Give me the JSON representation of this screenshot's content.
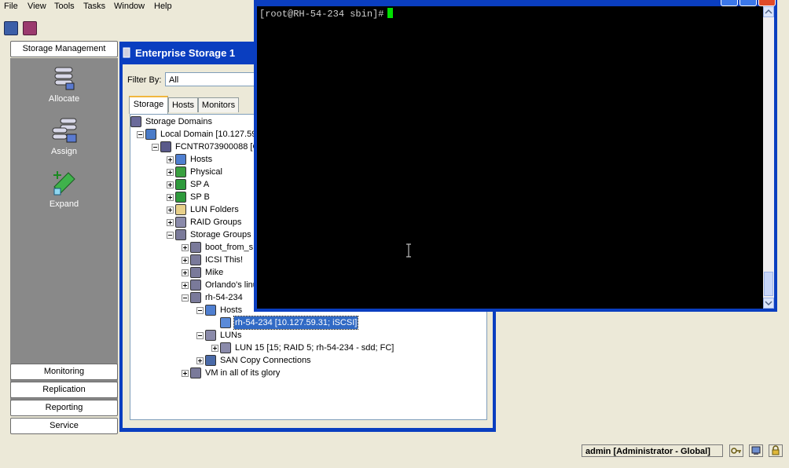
{
  "menu": [
    "File",
    "View",
    "Tools",
    "Tasks",
    "Window",
    "Help"
  ],
  "nav": {
    "storage_management": "Storage Management",
    "tools": [
      {
        "label": "Allocate",
        "icon": "allocate-icon"
      },
      {
        "label": "Assign",
        "icon": "assign-icon"
      },
      {
        "label": "Expand",
        "icon": "expand-icon"
      }
    ],
    "bottom": [
      "Monitoring",
      "Replication",
      "Reporting",
      "Service"
    ]
  },
  "enterprise_window": {
    "title": "Enterprise Storage 1",
    "filter_label": "Filter By:",
    "filter_value": "All",
    "tabs": [
      "Storage",
      "Hosts",
      "Monitors"
    ],
    "active_tab": "Storage"
  },
  "tree": [
    {
      "label": "Storage Domains",
      "depth": 0,
      "expander": "none",
      "icon": "storage-domains-icon"
    },
    {
      "label": "Local Domain [10.127.59",
      "depth": 1,
      "expander": "minus",
      "icon": "domain-icon"
    },
    {
      "label": "FCNTR073900088 [C",
      "depth": 2,
      "expander": "minus",
      "icon": "array-icon"
    },
    {
      "label": "Hosts",
      "depth": 3,
      "expander": "plus",
      "icon": "hosts-icon"
    },
    {
      "label": "Physical",
      "depth": 3,
      "expander": "plus",
      "icon": "physical-icon"
    },
    {
      "label": "SP A",
      "depth": 3,
      "expander": "plus",
      "icon": "sp-icon"
    },
    {
      "label": "SP B",
      "depth": 3,
      "expander": "plus",
      "icon": "sp-icon"
    },
    {
      "label": "LUN Folders",
      "depth": 3,
      "expander": "plus",
      "icon": "folder-icon"
    },
    {
      "label": "RAID Groups",
      "depth": 3,
      "expander": "plus",
      "icon": "raid-icon"
    },
    {
      "label": "Storage Groups",
      "depth": 3,
      "expander": "minus",
      "icon": "storage-group-icon"
    },
    {
      "label": "boot_from_s",
      "depth": 4,
      "expander": "plus",
      "icon": "storage-group-icon"
    },
    {
      "label": "ICSI This!",
      "depth": 4,
      "expander": "plus",
      "icon": "storage-group-icon"
    },
    {
      "label": "Mike",
      "depth": 4,
      "expander": "plus",
      "icon": "storage-group-icon"
    },
    {
      "label": "Orlando's linu",
      "depth": 4,
      "expander": "plus",
      "icon": "storage-group-icon"
    },
    {
      "label": "rh-54-234",
      "depth": 4,
      "expander": "minus",
      "icon": "storage-group-icon"
    },
    {
      "label": "Hosts",
      "depth": 5,
      "expander": "minus",
      "icon": "hosts-icon"
    },
    {
      "label": "rh-54-234 [10.127.59.31; iSCSI]",
      "depth": 6,
      "expander": "none",
      "icon": "host-icon",
      "selected": true
    },
    {
      "label": "LUNs",
      "depth": 5,
      "expander": "minus",
      "icon": "luns-icon"
    },
    {
      "label": "LUN 15 [15; RAID 5; rh-54-234 - sdd; FC]",
      "depth": 6,
      "expander": "plus",
      "icon": "lun-icon"
    },
    {
      "label": "SAN Copy Connections",
      "depth": 5,
      "expander": "plus",
      "icon": "san-copy-icon"
    },
    {
      "label": "VM in all of its glory",
      "depth": 4,
      "expander": "plus",
      "icon": "storage-group-icon"
    }
  ],
  "terminal": {
    "prompt": "[root@RH-54-234 sbin]#"
  },
  "status": {
    "user": "admin [Administrator - Global]"
  },
  "colors": {
    "title_blue": "#0a3ec0",
    "selection": "#316ac5",
    "nav_panel": "#898989",
    "cursor": "#00e000"
  }
}
